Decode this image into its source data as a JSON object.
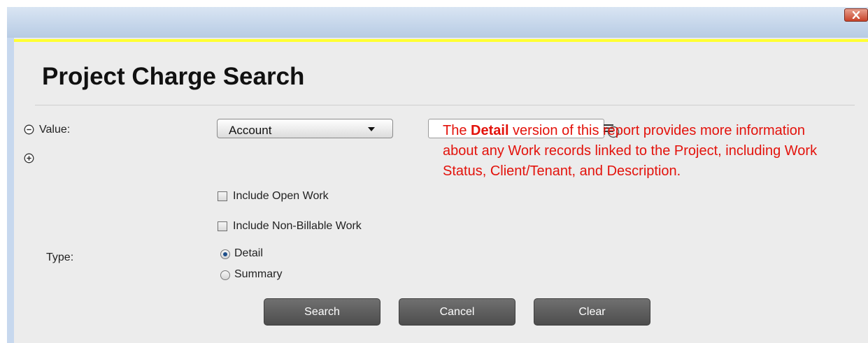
{
  "window": {
    "close_icon": "close-x-icon"
  },
  "header": {
    "title": "Project Charge Search"
  },
  "filters": {
    "value_label": "Value:",
    "collapse_icon": "minus-circle-icon",
    "add_icon": "plus-circle-icon",
    "field_select": {
      "selected": "Account",
      "icon": "chevron-down-icon"
    },
    "value_input": {
      "value": "",
      "list_icon": "list-icon",
      "help_icon": "help-circle-icon"
    }
  },
  "options": {
    "include_open_work": {
      "label": "Include Open Work",
      "checked": false
    },
    "include_non_billable": {
      "label": "Include Non-Billable Work",
      "checked": false
    }
  },
  "type": {
    "label": "Type:",
    "options": [
      {
        "label": "Detail",
        "selected": true
      },
      {
        "label": "Summary",
        "selected": false
      }
    ]
  },
  "buttons": {
    "search": "Search",
    "cancel": "Cancel",
    "clear": "Clear"
  },
  "tooltip": {
    "prefix": "The ",
    "bold": "Detail",
    "suffix": " version of this report provides more information about any Work records linked to the Project, including Work Status, Client/Tenant, and Description.",
    "color": "#e3120b"
  }
}
